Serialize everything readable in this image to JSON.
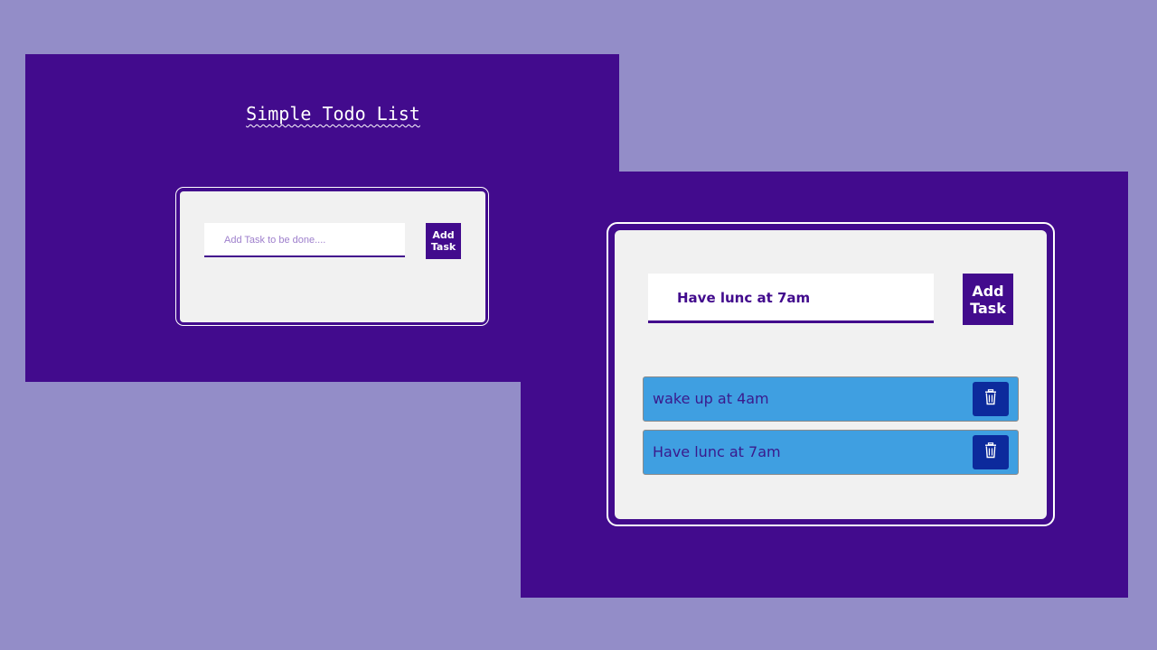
{
  "left_view": {
    "title": "Simple Todo List",
    "input": {
      "placeholder": "Add Task to be done....",
      "value": ""
    },
    "add_button_label": "Add\nTask"
  },
  "right_view": {
    "input": {
      "placeholder": "Add Task to be done....",
      "value": "Have lunc at 7am"
    },
    "add_button_label": "Add\nTask",
    "tasks": [
      {
        "text": "wake up at 4am",
        "delete_icon": "trash-icon"
      },
      {
        "text": "Have lunc at 7am",
        "delete_icon": "trash-icon"
      }
    ]
  },
  "colors": {
    "background": "#938dc8",
    "primary": "#420b8d",
    "card": "#f1f1f1",
    "task_item": "#3f9fe1",
    "delete_button": "#0c2a9c"
  }
}
